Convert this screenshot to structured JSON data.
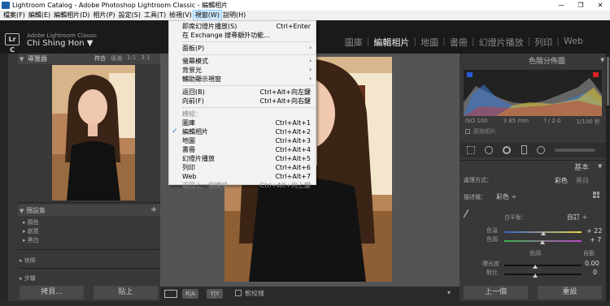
{
  "window": {
    "title": "Lightroom Catalog - Adobe Photoshop Lightroom Classic - 編輯相片",
    "min_glyph": "—",
    "max_glyph": "❐",
    "close_glyph": "✕"
  },
  "menubar": [
    {
      "label": "檔案(F)"
    },
    {
      "label": "編輯(E)"
    },
    {
      "label": "編輯相片(D)"
    },
    {
      "label": "相片(P)"
    },
    {
      "label": "設定(S)"
    },
    {
      "label": "工具(T)"
    },
    {
      "label": "檢視(V)"
    },
    {
      "label": "視窗(W)",
      "active": true
    },
    {
      "label": "說明(H)"
    }
  ],
  "identity": {
    "logo": "Lr C",
    "app": "Adobe Lightroom Classic",
    "user": "Chi Shing Hon ▼"
  },
  "modules": [
    {
      "label": "圖庫"
    },
    {
      "label": "編輯相片",
      "active": true
    },
    {
      "label": "地圖"
    },
    {
      "label": "書冊"
    },
    {
      "label": "幻燈片播放"
    },
    {
      "label": "列印"
    },
    {
      "label": "Web"
    }
  ],
  "left": {
    "navigator_title": "導覽器",
    "navigator_opts": [
      "符合",
      "填滿",
      "1:1",
      "3:1"
    ],
    "presets_title": "預設集",
    "presets": [
      "顏色",
      "創意",
      "黑白"
    ],
    "snapshots": "快照",
    "history": "步驟",
    "buttons": {
      "copy": "拷貝...",
      "paste": "貼上"
    }
  },
  "toolbar": {
    "softproof": "軟校樣"
  },
  "right": {
    "histogram_title": "色階分佈圖",
    "hist_info": [
      "ISO 100",
      "3.85 mm",
      "f / 2.0",
      "1/100 秒"
    ],
    "original_photo": "原始相片",
    "basic_title": "基本",
    "treatment_label": "處理方式：",
    "treatment_color": "彩色",
    "treatment_bw": "黑白",
    "profile_label": "描述檔：",
    "profile_value": "彩色 ÷",
    "wb_label": "白平衡：",
    "wb_value": "自訂 ÷",
    "temp_label": "色溫",
    "temp_value": "+ 22",
    "tint_label": "色調",
    "tint_value": "+ 7",
    "tone_label": "色調",
    "auto_label": "自動",
    "exposure_label": "曝光度",
    "exposure_value": "0.00",
    "contrast_label": "對比",
    "contrast_value": "0",
    "buttons": {
      "prev": "上一個",
      "reset": "重設"
    }
  },
  "window_menu": {
    "items": [
      {
        "label": "即席幻燈片播放(S)",
        "shortcut": "Ctrl+Enter"
      },
      {
        "label": "在 Exchange 搜尋額外功能...",
        "shortcut": ""
      },
      {
        "sep": true
      },
      {
        "label": "面板(P)",
        "submenu": true
      },
      {
        "sep": true
      },
      {
        "label": "螢幕模式",
        "submenu": true
      },
      {
        "label": "背景光",
        "submenu": true
      },
      {
        "label": "輔助顯示視窗",
        "submenu": true
      },
      {
        "sep": true
      },
      {
        "label": "返回(B)",
        "shortcut": "Ctrl+Alt+向左鍵"
      },
      {
        "label": "向前(F)",
        "shortcut": "Ctrl+Alt+向右鍵"
      },
      {
        "sep": true
      },
      {
        "label": "模組：",
        "disabled": true
      },
      {
        "label": "圖庫",
        "shortcut": "Ctrl+Alt+1"
      },
      {
        "label": "編輯相片",
        "shortcut": "Ctrl+Alt+2",
        "checked": true
      },
      {
        "label": "地圖",
        "shortcut": "Ctrl+Alt+3"
      },
      {
        "label": "書冊",
        "shortcut": "Ctrl+Alt+4"
      },
      {
        "label": "幻燈片播放",
        "shortcut": "Ctrl+Alt+5"
      },
      {
        "label": "列印",
        "shortcut": "Ctrl+Alt+6"
      },
      {
        "label": "Web",
        "shortcut": "Ctrl+Alt+7"
      },
      {
        "label": "返回上一個模組",
        "shortcut": "Ctrl+Alt+向上鍵",
        "disabled": true
      }
    ]
  }
}
